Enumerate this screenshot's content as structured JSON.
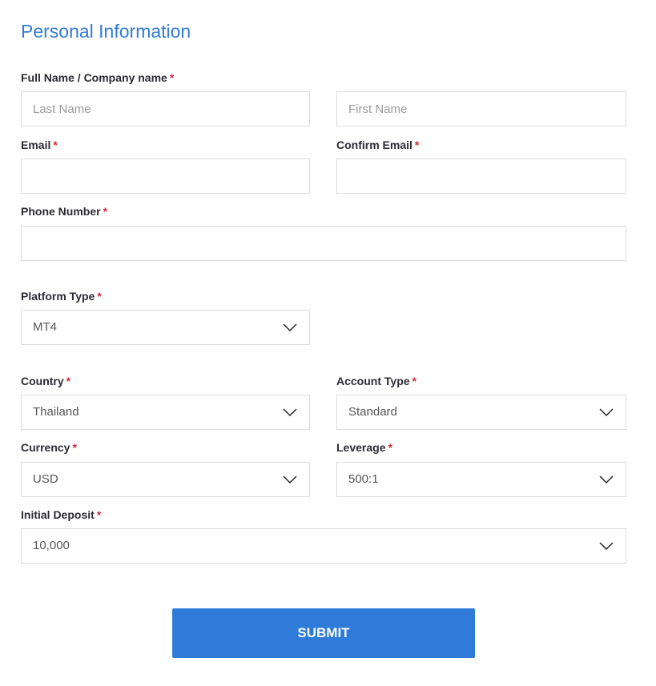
{
  "section_title": "Personal Information",
  "colors": {
    "accent": "#2f7bd7",
    "required": "#d0283a",
    "button": "#2f7bd9"
  },
  "required_marker": "*",
  "fields": {
    "full_name": {
      "label": "Full Name / Company name",
      "last_placeholder": "Last Name",
      "first_placeholder": "First Name"
    },
    "email": {
      "label": "Email",
      "value": ""
    },
    "confirm_email": {
      "label": "Confirm Email",
      "value": ""
    },
    "phone": {
      "label": "Phone Number",
      "value": ""
    },
    "platform_type": {
      "label": "Platform Type",
      "selected": "MT4"
    },
    "country": {
      "label": "Country",
      "selected": "Thailand"
    },
    "account_type": {
      "label": "Account Type",
      "selected": "Standard"
    },
    "currency": {
      "label": "Currency",
      "selected": "USD"
    },
    "leverage": {
      "label": "Leverage",
      "selected": "500:1"
    },
    "initial_deposit": {
      "label": "Initial Deposit",
      "selected": "10,000"
    }
  },
  "icons": {
    "dropdown": "chevron-down-icon"
  },
  "submit_label": "SUBMIT"
}
